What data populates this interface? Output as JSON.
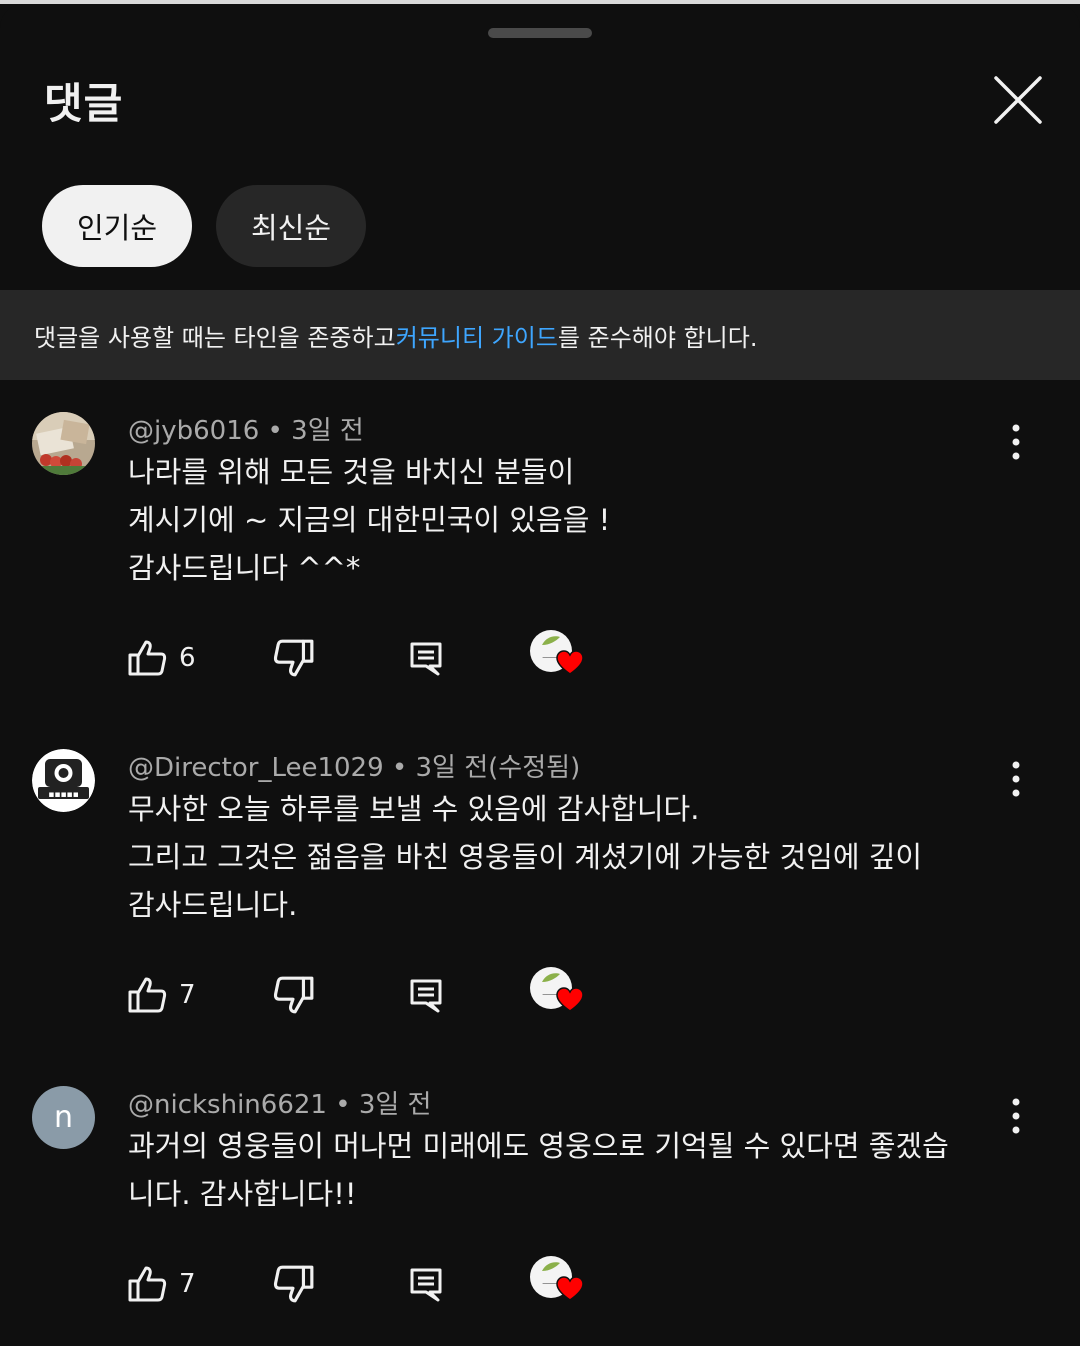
{
  "header": {
    "title": "댓글",
    "close_icon": "close-icon"
  },
  "sort_chips": [
    {
      "label": "인기순",
      "active": true
    },
    {
      "label": "최신순",
      "active": false
    }
  ],
  "banner": {
    "prefix": "댓글을 사용할 때는 타인을 존중하고 ",
    "link": "커뮤니티 가이드",
    "suffix": "를 준수해야 합니다."
  },
  "comments": [
    {
      "author": "@jyb6016",
      "separator": " • ",
      "time": "3일 전",
      "lines": [
        "나라를 위해 모든 것을 바치신 분들이",
        "계시기에 ~ 지금의 대한민국이 있음을 !",
        "감사드립니다 ^^*"
      ],
      "likes": "6",
      "creator_heart": true
    },
    {
      "author": "@Director_Lee1029",
      "separator": " • ",
      "time": "3일 전(수정됨)",
      "lines": [
        "무사한 오늘 하루를 보낼 수 있음에 감사합니다.",
        "그리고 그것은 젊음을 바친 영웅들이 계셨기에 가능한 것임에 깊이",
        "감사드립니다."
      ],
      "likes": "7",
      "creator_heart": true
    },
    {
      "author": "@nickshin6621",
      "separator": " • ",
      "time": "3일 전",
      "avatar_letter": "n",
      "lines": [
        "과거의 영웅들이 머나먼 미래에도 영웅으로 기억될 수 있다면 좋겠습",
        "니다. 감사합니다!!"
      ],
      "likes": "7",
      "creator_heart": true
    }
  ],
  "colors": {
    "background": "#0f0f0f",
    "surface": "#272727",
    "link": "#3ea6ff",
    "heart": "#ff0000",
    "avatar_n": "#8a9ba8"
  }
}
